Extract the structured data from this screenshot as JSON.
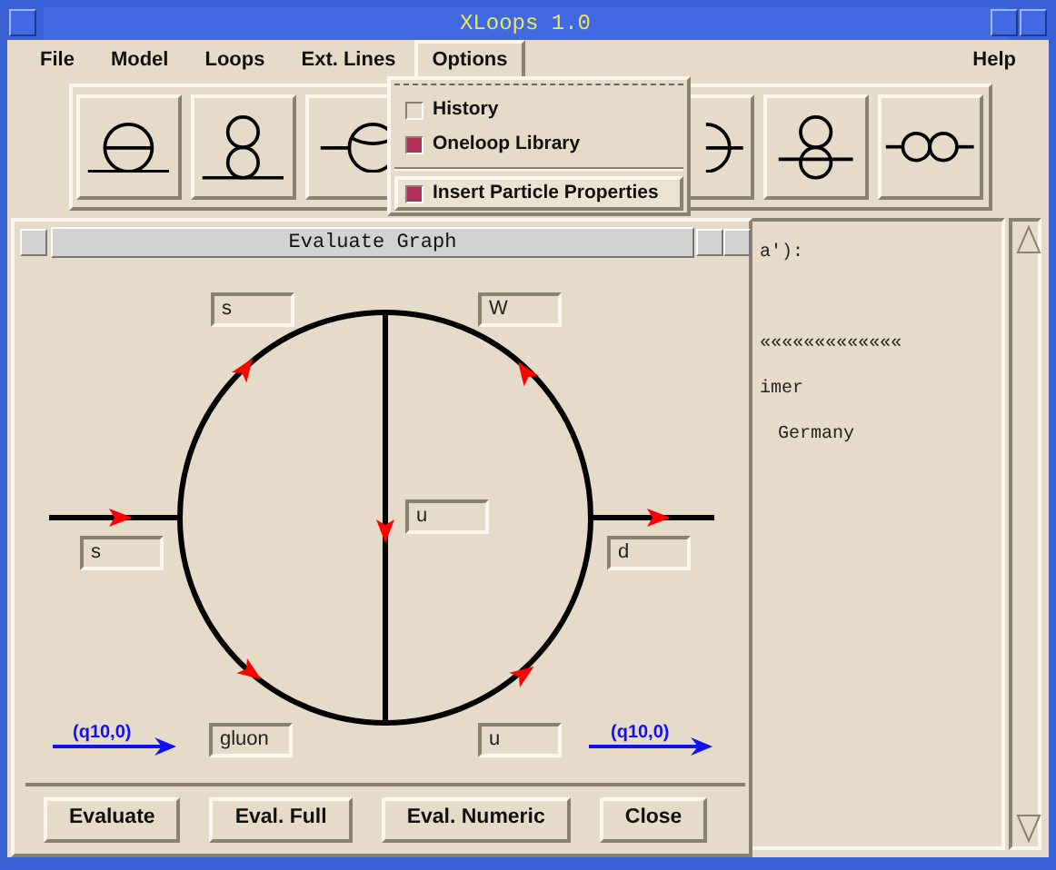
{
  "main_window": {
    "title": "XLoops 1.0",
    "menu": [
      {
        "label": "File",
        "selected": false
      },
      {
        "label": "Model",
        "selected": false
      },
      {
        "label": "Loops",
        "selected": false
      },
      {
        "label": "Ext. Lines",
        "selected": false
      },
      {
        "label": "Options",
        "selected": true
      },
      {
        "label": "Help",
        "selected": false
      }
    ],
    "toolbar": [
      {
        "kind": "theta-line"
      },
      {
        "kind": "eight-line"
      },
      {
        "kind": "cap-circle"
      },
      {
        "kind": "covered"
      },
      {
        "kind": "covered"
      },
      {
        "kind": "theta-through"
      },
      {
        "kind": "eight-cross"
      },
      {
        "kind": "double-bubble"
      }
    ],
    "options_menu": [
      {
        "kind": "tearoff"
      },
      {
        "kind": "check",
        "label": "History",
        "checked": false,
        "highlighted": false
      },
      {
        "kind": "check",
        "label": "Oneloop Library",
        "checked": true,
        "highlighted": false
      },
      {
        "kind": "separator"
      },
      {
        "kind": "check",
        "label": "Insert Particle Properties",
        "checked": true,
        "highlighted": true
      }
    ],
    "text_lines": [
      {
        "text": "a'):",
        "blank_before": false,
        "indented": false
      },
      {
        "text": "«««««««««««««",
        "blank_before": true,
        "indented": false
      },
      {
        "text": "imer",
        "blank_before": false,
        "indented": false
      },
      {
        "text": "Germany",
        "blank_before": false,
        "indented": true
      }
    ]
  },
  "evaluate_window": {
    "title": "Evaluate Graph",
    "fields": [
      {
        "value": "s"
      },
      {
        "value": "W"
      },
      {
        "value": "u"
      },
      {
        "value": "s"
      },
      {
        "value": "d"
      },
      {
        "value": "gluon"
      },
      {
        "value": "u"
      }
    ],
    "momenta": [
      "(q10,0)",
      "(q10,0)"
    ],
    "buttons": [
      "Evaluate",
      "Eval. Full",
      "Eval. Numeric",
      "Close"
    ]
  }
}
